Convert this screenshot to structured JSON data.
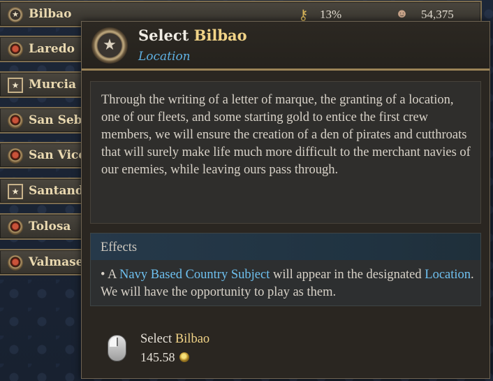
{
  "locations": [
    {
      "name": "Bilbao",
      "icon": "round-star"
    },
    {
      "name": "Laredo",
      "icon": "round"
    },
    {
      "name": "Murcia",
      "icon": "square-star"
    },
    {
      "name": "San Seba",
      "icon": "round"
    },
    {
      "name": "San Vice",
      "icon": "round"
    },
    {
      "name": "Santand",
      "icon": "square-star"
    },
    {
      "name": "Tolosa",
      "icon": "round"
    },
    {
      "name": "Valmase",
      "icon": "round"
    }
  ],
  "top_row_stats": {
    "percent": "13%",
    "population": "54,375"
  },
  "tooltip": {
    "title_prefix": "Select ",
    "title_name": "Bilbao",
    "subtitle": "Location",
    "description": "Through the writing of a letter of marque, the granting of a location, one of our fleets, and some starting gold to entice the first crew members, we will ensure the creation of a den of pirates and cutthroats that will surely make life much more difficult to the merchant navies of our enemies, while leaving ours pass through.",
    "effects_title": "Effects",
    "effect": {
      "bullet": "• A ",
      "link1": "Navy Based Country Subject",
      "middle": " will appear in the designated ",
      "link2": "Location",
      "end": ". We will have the opportunity to play as them."
    },
    "action": {
      "prefix": "Select ",
      "name": "Bilbao",
      "cost": "145.58"
    }
  },
  "colors": {
    "gold_text": "#f1d387",
    "link_blue": "#6ec0ef",
    "subtitle_blue": "#5fb0e2"
  }
}
